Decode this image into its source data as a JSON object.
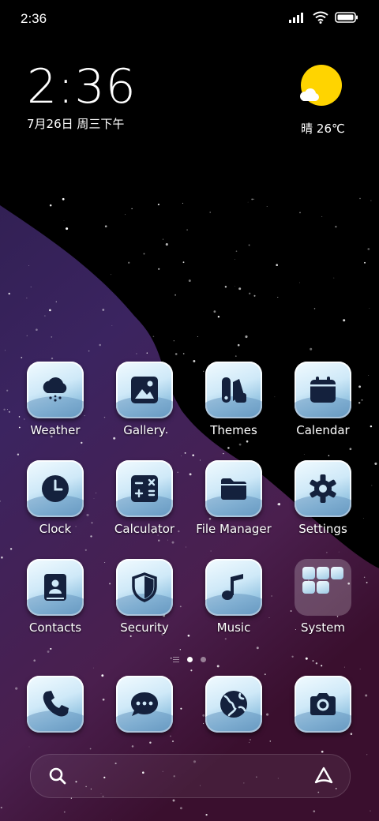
{
  "status_bar": {
    "time": "2:36"
  },
  "clock_widget": {
    "time": "2:36",
    "date": "7月26日 周三下午"
  },
  "weather_widget": {
    "condition_temp": "晴 26℃",
    "icon": "sun-cloud-icon",
    "sun_color": "#ffd400"
  },
  "home_apps": [
    {
      "label": "Weather",
      "icon": "cloud-snow-icon"
    },
    {
      "label": "Gallery",
      "icon": "image-icon"
    },
    {
      "label": "Themes",
      "icon": "themes-icon"
    },
    {
      "label": "Calendar",
      "icon": "calendar-icon"
    },
    {
      "label": "Clock",
      "icon": "clock-icon"
    },
    {
      "label": "Calculator",
      "icon": "calculator-icon"
    },
    {
      "label": "File Manager",
      "icon": "folder-icon"
    },
    {
      "label": "Settings",
      "icon": "gear-icon"
    },
    {
      "label": "Contacts",
      "icon": "contacts-book-icon"
    },
    {
      "label": "Security",
      "icon": "shield-icon"
    },
    {
      "label": "Music",
      "icon": "music-note-icon"
    },
    {
      "label": "System",
      "icon": "folder-grid-icon"
    }
  ],
  "dock": [
    {
      "icon": "phone-icon"
    },
    {
      "icon": "message-icon"
    },
    {
      "icon": "globe-icon"
    },
    {
      "icon": "camera-icon"
    }
  ],
  "search_bar": {
    "left_icon": "search-icon",
    "right_icon": "assistant-icon"
  },
  "page_indicator": {
    "current_page": 1,
    "total_pages": 2
  },
  "colors": {
    "glyph": "#14213d",
    "icon_light": "#eaf6fd",
    "icon_dark": "#6fa3c8"
  }
}
